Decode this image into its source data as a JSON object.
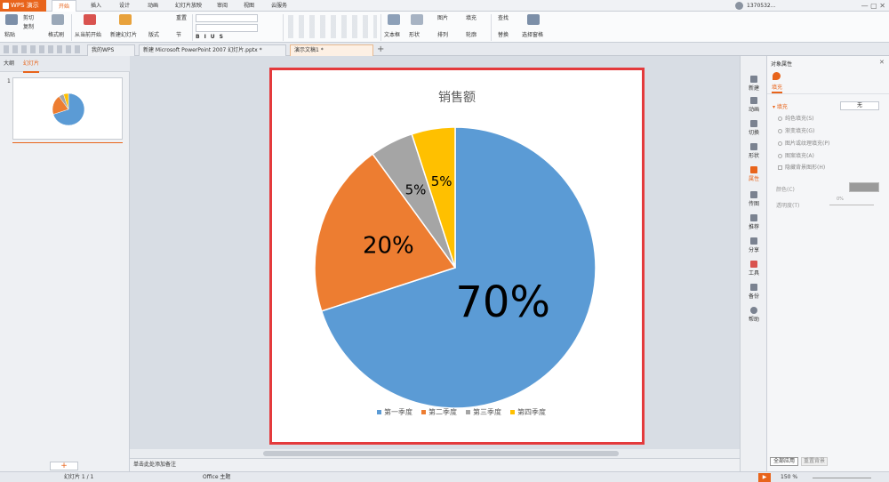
{
  "app": {
    "name": "WPS 演示",
    "user": "1370532..."
  },
  "menu_tabs": [
    "开始",
    "插入",
    "设计",
    "动画",
    "幻灯片放映",
    "审阅",
    "视图",
    "云服务"
  ],
  "ribbon": {
    "paste": "粘贴",
    "cut": "剪切",
    "copy": "复制",
    "format_painter": "格式刷",
    "from_current": "从当前开始",
    "new_slide": "新建幻灯片",
    "layout": "版式",
    "reset": "重置",
    "section": "节",
    "textbox": "文本框",
    "shape": "形状",
    "picture": "图片",
    "fill": "填充",
    "arrange": "排列",
    "outline": "轮廓",
    "find": "查找",
    "replace": "替换",
    "select_pane": "选择窗格"
  },
  "doc_tabs": [
    "我的WPS",
    "新建 Microsoft PowerPoint 2007 幻灯片.pptx *",
    "演示文稿1 *"
  ],
  "left_panel": {
    "outline_tab": "大纲",
    "slides_tab": "幻灯片",
    "slide_number": "1"
  },
  "chart_data": {
    "type": "pie",
    "title": "销售额",
    "categories": [
      "第一季度",
      "第二季度",
      "第三季度",
      "第四季度"
    ],
    "values": [
      70,
      20,
      5,
      5
    ],
    "data_labels": [
      "70%",
      "20%",
      "5%",
      "5%"
    ],
    "colors": [
      "#5b9bd5",
      "#ed7d31",
      "#a5a5a5",
      "#ffc000"
    ],
    "legend_position": "bottom"
  },
  "notes_placeholder": "单击此处添加备注",
  "right_toolbar": [
    "新建",
    "动画",
    "切换",
    "形状",
    "属性",
    "传图",
    "推荐",
    "分享",
    "工具",
    "备份",
    "帮助"
  ],
  "properties": {
    "title": "对象属性",
    "fill_tab": "填充",
    "fill_section": "填充",
    "none_button": "无",
    "options": [
      "纯色填充(S)",
      "渐变填充(G)",
      "图片或纹理填充(P)",
      "图案填充(A)",
      "隐藏背景图形(H)"
    ],
    "color_label": "颜色(C)",
    "transparency_label": "透明度(T)",
    "transparency_value": "0%",
    "apply_all": "全部应用",
    "reset_bg": "重置背景"
  },
  "status": {
    "slide_counter": "幻灯片 1 / 1",
    "theme": "Office 主题",
    "zoom": "150 %"
  },
  "accent": "#e8641b"
}
